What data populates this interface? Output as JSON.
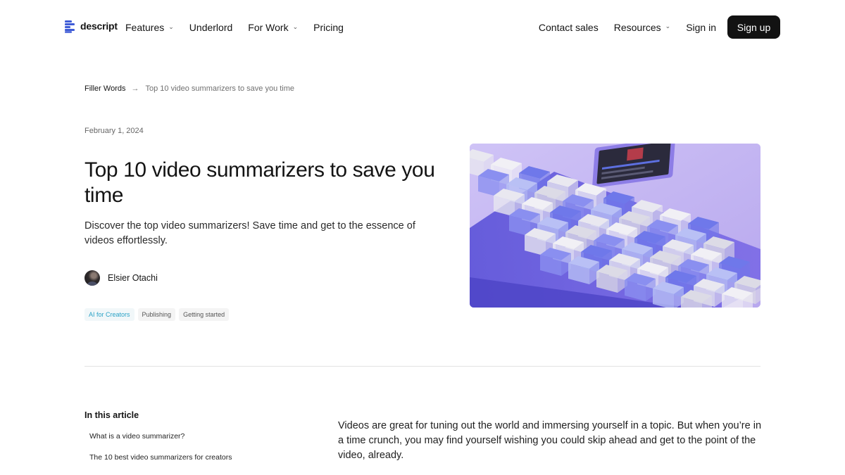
{
  "nav": {
    "logo_text": "descript",
    "left_items": [
      {
        "label": "Features",
        "dropdown": true
      },
      {
        "label": "Underlord",
        "dropdown": false
      },
      {
        "label": "For Work",
        "dropdown": true
      },
      {
        "label": "Pricing",
        "dropdown": false
      }
    ],
    "right_items": [
      {
        "label": "Contact sales",
        "dropdown": false
      },
      {
        "label": "Resources",
        "dropdown": true
      },
      {
        "label": "Sign in",
        "dropdown": false
      }
    ],
    "signup_label": "Sign up",
    "chevron_glyph": "⌄"
  },
  "breadcrumb": {
    "parent": "Filler Words",
    "arrow": "→",
    "current": "Top 10 video summarizers to save you time"
  },
  "article": {
    "date": "February 1, 2024",
    "title": "Top 10 video summarizers to save you time",
    "subtitle": "Discover the top video summarizers! Save time and get to the essence of videos effortlessly.",
    "author": "Elsier Otachi",
    "tags": [
      "AI for Creators",
      "Publishing",
      "Getting started"
    ],
    "hero_icon": "keyboard-illustration"
  },
  "toc": {
    "heading": "In this article",
    "items": [
      "What is a video summarizer?",
      "The 10 best video summarizers for creators"
    ]
  },
  "body": {
    "intro": "Videos are great for tuning out the world and immersing yourself in a topic. But when you’re in a time crunch, you may find yourself wishing you could skip ahead and get to the point of the video, already."
  },
  "colors": {
    "accent": "#2aa2c6",
    "logo": "#3f5cd6",
    "signup_bg": "#121212",
    "hero_bg": "#c5b9f2"
  }
}
